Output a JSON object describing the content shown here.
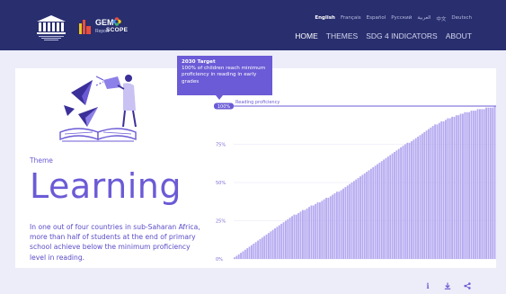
{
  "header": {
    "logo_gem": "GEM",
    "logo_gem_sub": "Report",
    "logo_scope": "SCOPE",
    "languages": [
      "English",
      "Français",
      "Español",
      "Русский",
      "العربية",
      "中文",
      "Deutsch"
    ],
    "active_language": "English",
    "nav": [
      "HOME",
      "THEMES",
      "SDG 4 INDICATORS",
      "ABOUT"
    ],
    "active_nav": "HOME"
  },
  "page": {
    "theme_label": "Theme",
    "title": "Learning",
    "summary": "In one out of four countries in sub-Saharan Africa, more than half of students at the end of primary school achieve below the minimum proficiency level in reading."
  },
  "tooltip": {
    "heading": "2030 Target",
    "body": "100% of children reach minimum proficiency in reading in early grades"
  },
  "chart_data": {
    "type": "bar",
    "ylabel": "Reading proficiency",
    "ylim": [
      0,
      100
    ],
    "yticks": [
      "0%",
      "25%",
      "50%",
      "75%",
      "100%"
    ],
    "target_label": "100%",
    "bar_color": "#b5aaf0",
    "values": [
      1,
      2,
      3,
      4,
      5,
      6,
      7,
      8,
      9,
      10,
      11,
      12,
      13,
      14,
      15,
      16,
      17,
      18,
      19,
      20,
      21,
      22,
      23,
      24,
      25,
      26,
      27,
      28,
      29,
      29,
      30,
      31,
      32,
      32,
      33,
      34,
      35,
      35,
      36,
      37,
      37,
      38,
      39,
      40,
      40,
      41,
      42,
      43,
      44,
      44,
      45,
      46,
      47,
      48,
      49,
      50,
      51,
      52,
      53,
      54,
      55,
      56,
      57,
      58,
      59,
      60,
      61,
      62,
      63,
      64,
      65,
      66,
      67,
      68,
      69,
      70,
      71,
      72,
      73,
      74,
      75,
      76,
      76,
      77,
      78,
      79,
      80,
      81,
      82,
      83,
      84,
      85,
      86,
      87,
      88,
      88,
      89,
      90,
      90,
      91,
      92,
      92,
      93,
      93,
      94,
      94,
      95,
      95,
      96,
      96,
      96,
      97,
      97,
      97,
      98,
      98,
      98,
      98,
      99,
      99,
      99,
      99,
      100
    ]
  },
  "actions": [
    "info",
    "download",
    "share"
  ]
}
